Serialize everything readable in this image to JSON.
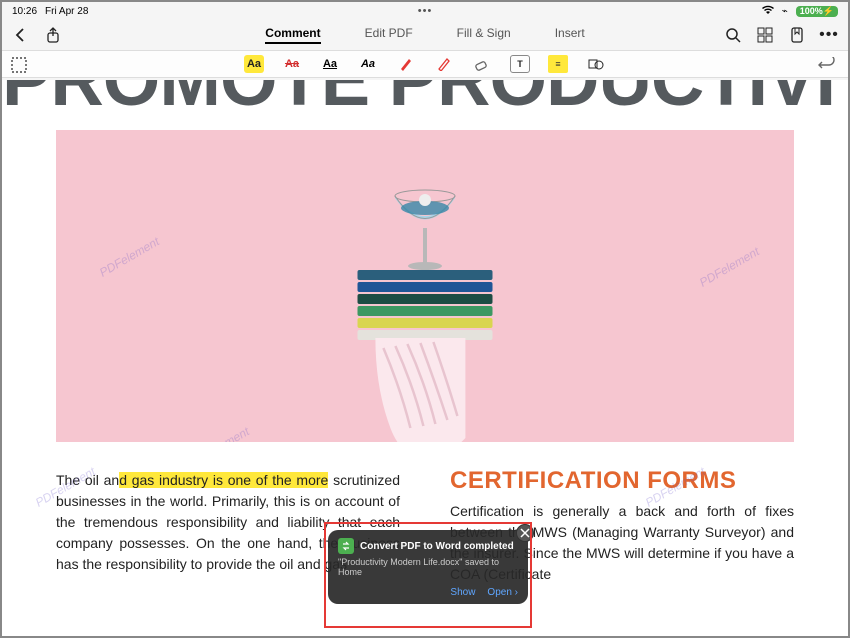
{
  "status": {
    "time": "10:26",
    "date": "Fri Apr 28",
    "dots": "•••",
    "battery": "100%",
    "battery_icon": "⚡"
  },
  "tabs": {
    "comment": "Comment",
    "editpdf": "Edit PDF",
    "fillsign": "Fill & Sign",
    "insert": "Insert"
  },
  "tools": {
    "aa1": "Aa",
    "aa2": "Aa",
    "aa3": "Aa",
    "aa4": "Aa"
  },
  "doc": {
    "title": "PROMOTE PRODUCTIVITY",
    "watermark": "PDFelement",
    "left_text_pre": "The oil an",
    "left_text_hl": "d gas industry is one of the more",
    "left_text_post": " scrutinized businesses in the world. Primarily, this is on account of the tremendous responsibility and liability that each company possesses. On the one hand, the business has the responsibility to provide the oil and gas",
    "right_heading": "CERTIFICATION FORMS",
    "right_text": "Certification is generally a back and forth of fixes between the MWS (Managing Warranty Surveyor) and the insurer. Since the MWS will determine if you have a COA (Certificate"
  },
  "toast": {
    "title": "Convert PDF to Word completed",
    "subtitle": "\"Productivity Modern Life.docx\" saved to Home",
    "show": "Show",
    "open": "Open"
  }
}
